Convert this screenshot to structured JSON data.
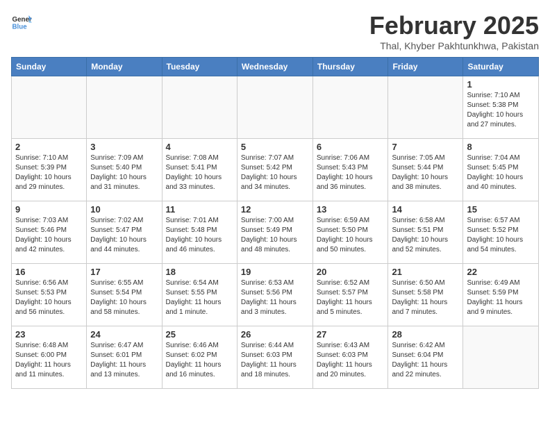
{
  "logo": {
    "general": "General",
    "blue": "Blue"
  },
  "title": "February 2025",
  "subtitle": "Thal, Khyber Pakhtunkhwa, Pakistan",
  "days_of_week": [
    "Sunday",
    "Monday",
    "Tuesday",
    "Wednesday",
    "Thursday",
    "Friday",
    "Saturday"
  ],
  "weeks": [
    [
      {
        "day": "",
        "info": ""
      },
      {
        "day": "",
        "info": ""
      },
      {
        "day": "",
        "info": ""
      },
      {
        "day": "",
        "info": ""
      },
      {
        "day": "",
        "info": ""
      },
      {
        "day": "",
        "info": ""
      },
      {
        "day": "1",
        "info": "Sunrise: 7:10 AM\nSunset: 5:38 PM\nDaylight: 10 hours\nand 27 minutes."
      }
    ],
    [
      {
        "day": "2",
        "info": "Sunrise: 7:10 AM\nSunset: 5:39 PM\nDaylight: 10 hours\nand 29 minutes."
      },
      {
        "day": "3",
        "info": "Sunrise: 7:09 AM\nSunset: 5:40 PM\nDaylight: 10 hours\nand 31 minutes."
      },
      {
        "day": "4",
        "info": "Sunrise: 7:08 AM\nSunset: 5:41 PM\nDaylight: 10 hours\nand 33 minutes."
      },
      {
        "day": "5",
        "info": "Sunrise: 7:07 AM\nSunset: 5:42 PM\nDaylight: 10 hours\nand 34 minutes."
      },
      {
        "day": "6",
        "info": "Sunrise: 7:06 AM\nSunset: 5:43 PM\nDaylight: 10 hours\nand 36 minutes."
      },
      {
        "day": "7",
        "info": "Sunrise: 7:05 AM\nSunset: 5:44 PM\nDaylight: 10 hours\nand 38 minutes."
      },
      {
        "day": "8",
        "info": "Sunrise: 7:04 AM\nSunset: 5:45 PM\nDaylight: 10 hours\nand 40 minutes."
      }
    ],
    [
      {
        "day": "9",
        "info": "Sunrise: 7:03 AM\nSunset: 5:46 PM\nDaylight: 10 hours\nand 42 minutes."
      },
      {
        "day": "10",
        "info": "Sunrise: 7:02 AM\nSunset: 5:47 PM\nDaylight: 10 hours\nand 44 minutes."
      },
      {
        "day": "11",
        "info": "Sunrise: 7:01 AM\nSunset: 5:48 PM\nDaylight: 10 hours\nand 46 minutes."
      },
      {
        "day": "12",
        "info": "Sunrise: 7:00 AM\nSunset: 5:49 PM\nDaylight: 10 hours\nand 48 minutes."
      },
      {
        "day": "13",
        "info": "Sunrise: 6:59 AM\nSunset: 5:50 PM\nDaylight: 10 hours\nand 50 minutes."
      },
      {
        "day": "14",
        "info": "Sunrise: 6:58 AM\nSunset: 5:51 PM\nDaylight: 10 hours\nand 52 minutes."
      },
      {
        "day": "15",
        "info": "Sunrise: 6:57 AM\nSunset: 5:52 PM\nDaylight: 10 hours\nand 54 minutes."
      }
    ],
    [
      {
        "day": "16",
        "info": "Sunrise: 6:56 AM\nSunset: 5:53 PM\nDaylight: 10 hours\nand 56 minutes."
      },
      {
        "day": "17",
        "info": "Sunrise: 6:55 AM\nSunset: 5:54 PM\nDaylight: 10 hours\nand 58 minutes."
      },
      {
        "day": "18",
        "info": "Sunrise: 6:54 AM\nSunset: 5:55 PM\nDaylight: 11 hours\nand 1 minute."
      },
      {
        "day": "19",
        "info": "Sunrise: 6:53 AM\nSunset: 5:56 PM\nDaylight: 11 hours\nand 3 minutes."
      },
      {
        "day": "20",
        "info": "Sunrise: 6:52 AM\nSunset: 5:57 PM\nDaylight: 11 hours\nand 5 minutes."
      },
      {
        "day": "21",
        "info": "Sunrise: 6:50 AM\nSunset: 5:58 PM\nDaylight: 11 hours\nand 7 minutes."
      },
      {
        "day": "22",
        "info": "Sunrise: 6:49 AM\nSunset: 5:59 PM\nDaylight: 11 hours\nand 9 minutes."
      }
    ],
    [
      {
        "day": "23",
        "info": "Sunrise: 6:48 AM\nSunset: 6:00 PM\nDaylight: 11 hours\nand 11 minutes."
      },
      {
        "day": "24",
        "info": "Sunrise: 6:47 AM\nSunset: 6:01 PM\nDaylight: 11 hours\nand 13 minutes."
      },
      {
        "day": "25",
        "info": "Sunrise: 6:46 AM\nSunset: 6:02 PM\nDaylight: 11 hours\nand 16 minutes."
      },
      {
        "day": "26",
        "info": "Sunrise: 6:44 AM\nSunset: 6:03 PM\nDaylight: 11 hours\nand 18 minutes."
      },
      {
        "day": "27",
        "info": "Sunrise: 6:43 AM\nSunset: 6:03 PM\nDaylight: 11 hours\nand 20 minutes."
      },
      {
        "day": "28",
        "info": "Sunrise: 6:42 AM\nSunset: 6:04 PM\nDaylight: 11 hours\nand 22 minutes."
      },
      {
        "day": "",
        "info": ""
      }
    ]
  ]
}
